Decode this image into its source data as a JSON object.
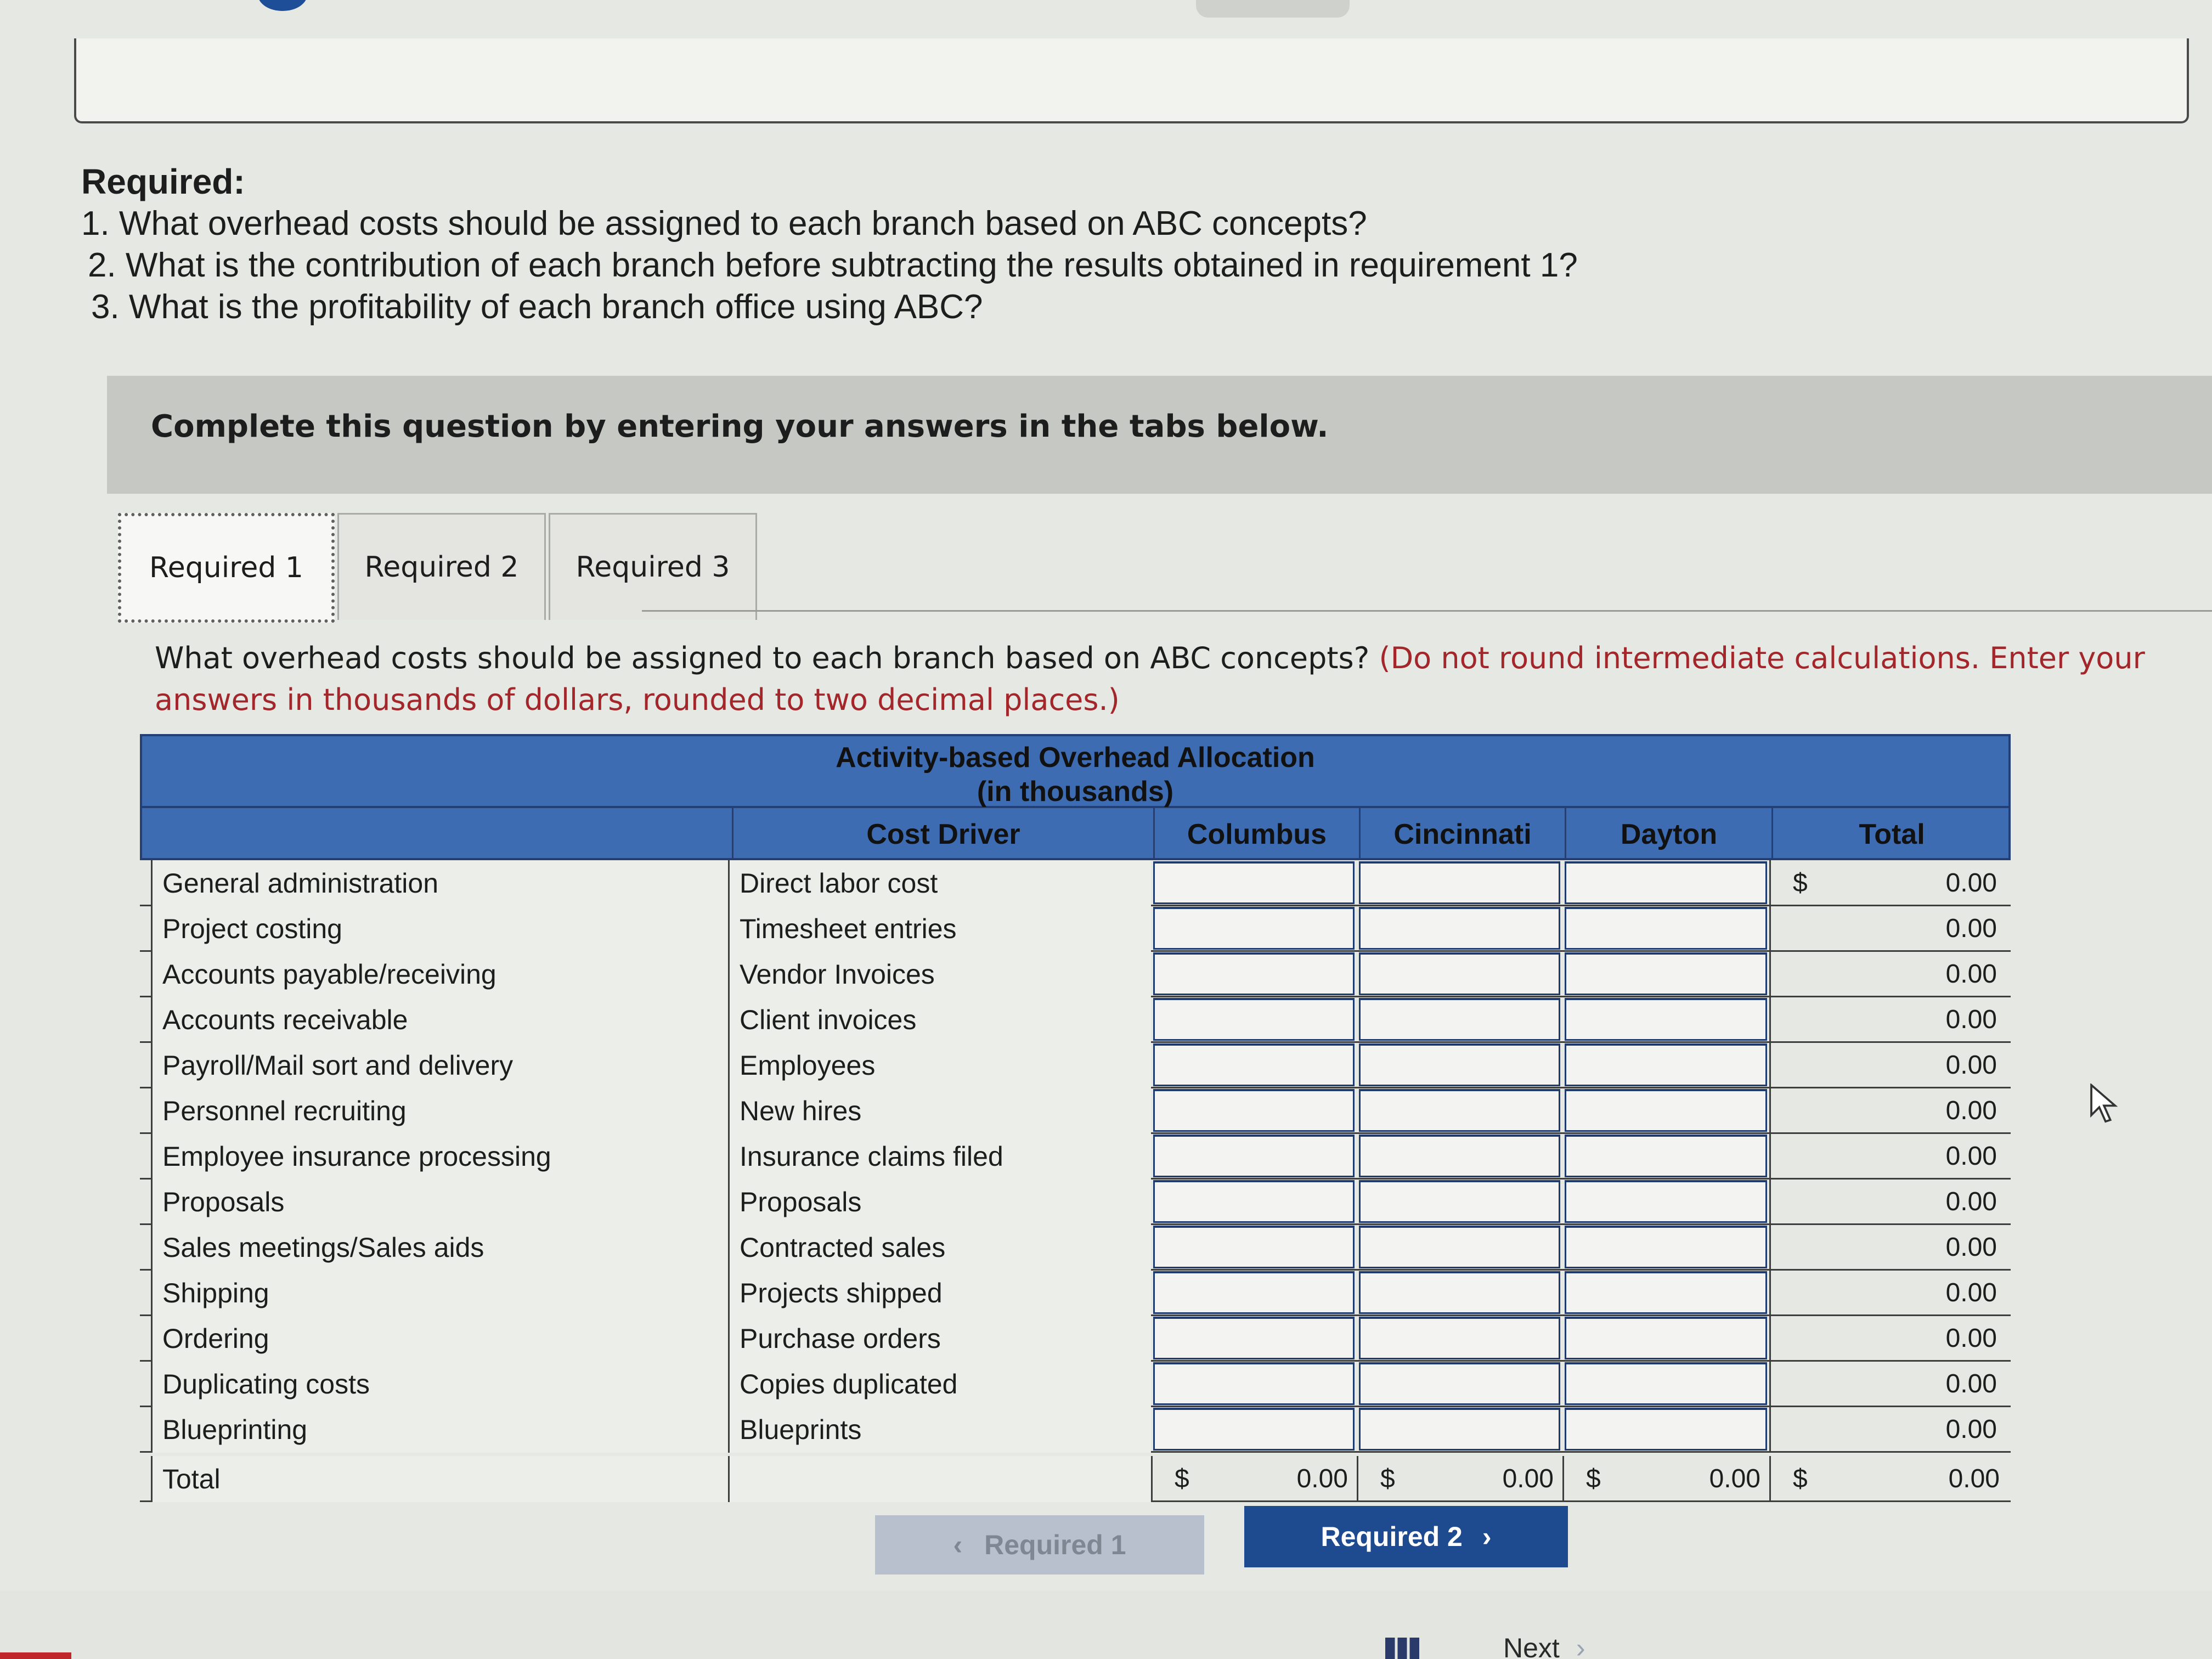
{
  "required": {
    "heading": "Required:",
    "items": [
      "1. What overhead costs should be assigned to each branch based on ABC concepts?",
      "2. What is the contribution of each branch before subtracting the results obtained in requirement 1?",
      "3. What is the profitability of each branch office using ABC?"
    ]
  },
  "banner": {
    "text": "Complete this question by entering your answers in the tabs below."
  },
  "tabs": [
    {
      "label": "Required 1",
      "active": true
    },
    {
      "label": "Required 2",
      "active": false
    },
    {
      "label": "Required 3",
      "active": false
    }
  ],
  "question": {
    "text": "What overhead costs should be assigned to each branch based on ABC concepts?",
    "note": "(Do not round intermediate calculations. Enter your answers in thousands of dollars, rounded to two decimal places.)"
  },
  "table": {
    "title_line1": "Activity-based Overhead Allocation",
    "title_line2": "(in thousands)",
    "headers": {
      "activity": "",
      "driver": "Cost Driver",
      "columbus": "Columbus",
      "cincinnati": "Cincinnati",
      "dayton": "Dayton",
      "total": "Total"
    },
    "currency": "$",
    "rows": [
      {
        "activity": "General administration",
        "driver": "Direct labor cost",
        "total": "0.00"
      },
      {
        "activity": "Project costing",
        "driver": "Timesheet entries",
        "total": "0.00"
      },
      {
        "activity": "Accounts payable/receiving",
        "driver": "Vendor Invoices",
        "total": "0.00"
      },
      {
        "activity": "Accounts receivable",
        "driver": "Client invoices",
        "total": "0.00"
      },
      {
        "activity": "Payroll/Mail sort and delivery",
        "driver": "Employees",
        "total": "0.00"
      },
      {
        "activity": "Personnel recruiting",
        "driver": "New hires",
        "total": "0.00"
      },
      {
        "activity": "Employee insurance processing",
        "driver": "Insurance claims filed",
        "total": "0.00"
      },
      {
        "activity": "Proposals",
        "driver": "Proposals",
        "total": "0.00"
      },
      {
        "activity": "Sales meetings/Sales aids",
        "driver": "Contracted sales",
        "total": "0.00"
      },
      {
        "activity": "Shipping",
        "driver": "Projects shipped",
        "total": "0.00"
      },
      {
        "activity": "Ordering",
        "driver": "Purchase orders",
        "total": "0.00"
      },
      {
        "activity": "Duplicating costs",
        "driver": "Copies duplicated",
        "total": "0.00"
      },
      {
        "activity": "Blueprinting",
        "driver": "Blueprints",
        "total": "0.00"
      }
    ],
    "total_row": {
      "label": "Total",
      "columbus": "0.00",
      "cincinnati": "0.00",
      "dayton": "0.00",
      "total": "0.00"
    }
  },
  "nav": {
    "prev_label": "Required 1",
    "next_label": "Required 2"
  },
  "footer": {
    "next_label": "Next"
  },
  "colors": {
    "header_blue": "#3d6cb2",
    "button_blue": "#1e4b8f",
    "note_red": "#a3262a"
  }
}
